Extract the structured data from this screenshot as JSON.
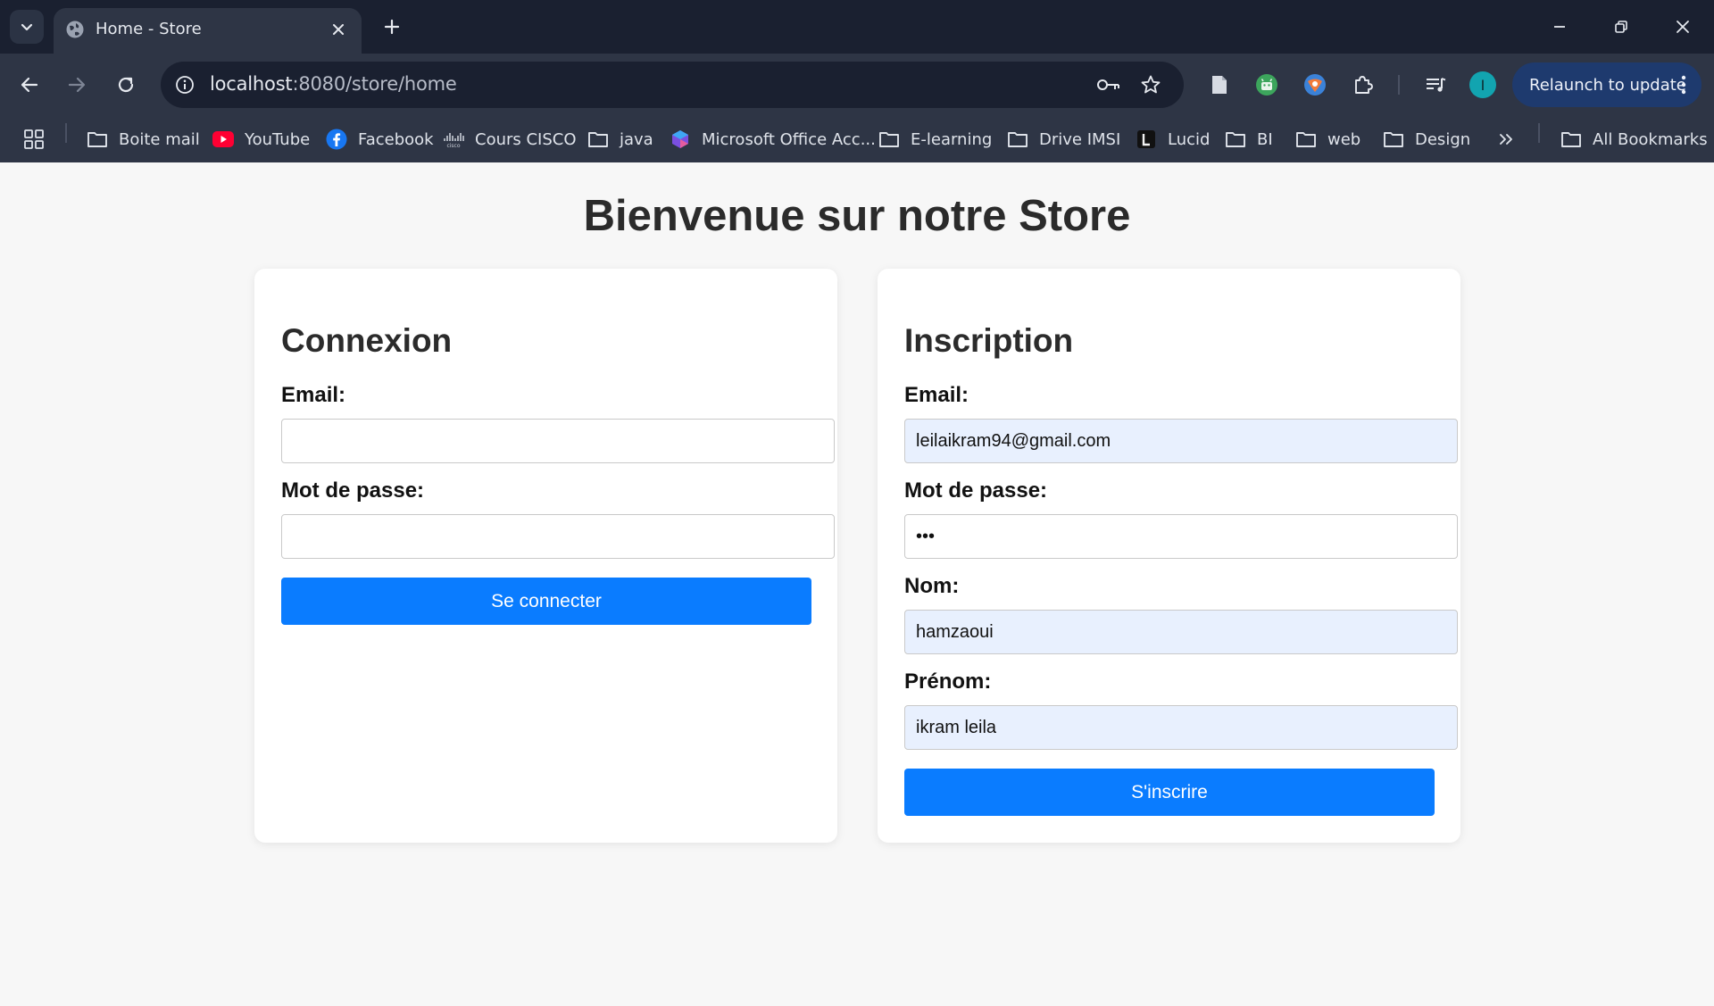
{
  "browser": {
    "tab": {
      "title": "Home - Store"
    },
    "url": {
      "host": "localhost",
      "path": ":8080/store/home"
    },
    "avatar_letter": "I",
    "relaunch_label": "Relaunch to update",
    "bookmarks": [
      {
        "label": "Boite mail",
        "icon": "folder-icon"
      },
      {
        "label": "YouTube",
        "icon": "youtube-icon"
      },
      {
        "label": "Facebook",
        "icon": "facebook-icon"
      },
      {
        "label": "Cours CISCO",
        "icon": "cisco-icon"
      },
      {
        "label": "java",
        "icon": "folder-icon"
      },
      {
        "label": "Microsoft Office Acc...",
        "icon": "copilot-icon"
      },
      {
        "label": "E-learning",
        "icon": "folder-icon"
      },
      {
        "label": "Drive IMSI",
        "icon": "folder-icon"
      },
      {
        "label": "Lucid",
        "icon": "lucid-icon"
      },
      {
        "label": "BI",
        "icon": "folder-icon"
      },
      {
        "label": "web",
        "icon": "folder-icon"
      },
      {
        "label": "Design",
        "icon": "folder-icon"
      }
    ],
    "all_bookmarks_label": "All Bookmarks",
    "colors": {
      "chrome_bg": "#1a2030",
      "toolbar_bg": "#2e3545",
      "relaunch_bg": "#1e3a6e",
      "avatar": "#12a4b0"
    }
  },
  "page": {
    "title": "Bienvenue sur notre Store",
    "login": {
      "heading": "Connexion",
      "email_label": "Email:",
      "email_value": "",
      "password_label": "Mot de passe:",
      "password_value": "",
      "submit_label": "Se connecter"
    },
    "register": {
      "heading": "Inscription",
      "email_label": "Email:",
      "email_value": "leilaikram94@gmail.com",
      "password_label": "Mot de passe:",
      "password_value": "•••",
      "nom_label": "Nom:",
      "nom_value": "hamzaoui",
      "prenom_label": "Prénom:",
      "prenom_value": "ikram leila",
      "submit_label": "S'inscrire"
    },
    "colors": {
      "primary_button": "#0a7cff",
      "autofill_bg": "#e8f0fe"
    }
  }
}
